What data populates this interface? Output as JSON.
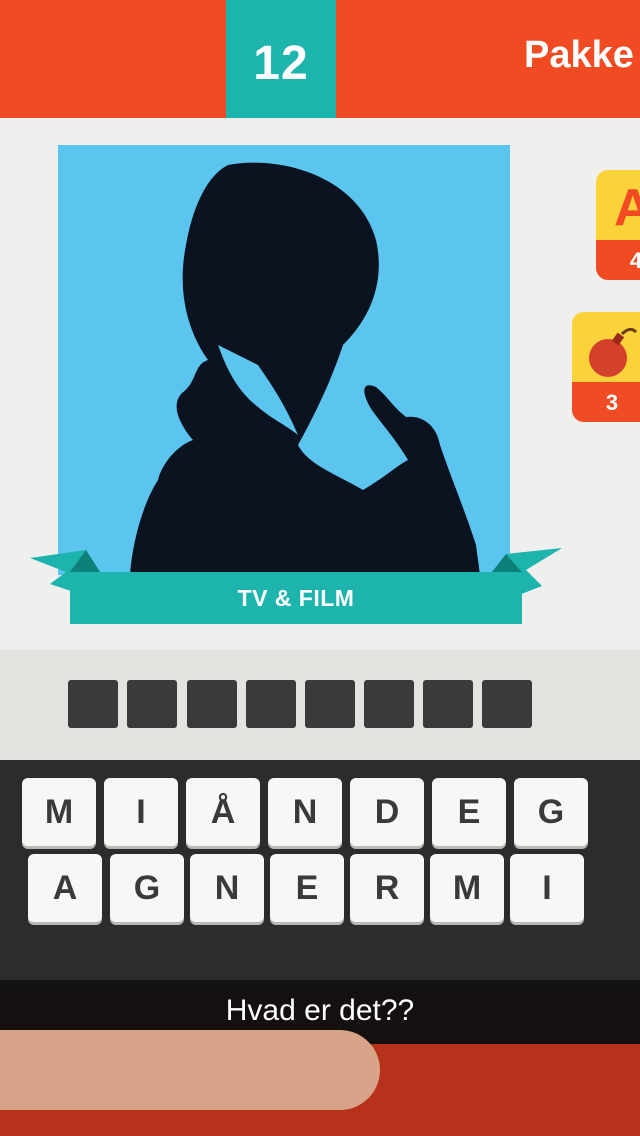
{
  "header": {
    "level_number": "12",
    "pack_label": "Pakke"
  },
  "picture": {
    "category_label": "TV & FILM"
  },
  "hints": [
    {
      "icon": "letter-hint-icon",
      "glyph": "A",
      "count": "4"
    },
    {
      "icon": "bomb-icon",
      "count": "3"
    }
  ],
  "answer": {
    "slot_count": 8
  },
  "keyboard": {
    "rows": [
      [
        "M",
        "I",
        "Å",
        "N",
        "D",
        "E",
        "G"
      ],
      [
        "A",
        "G",
        "N",
        "E",
        "R",
        "M",
        "I"
      ]
    ]
  },
  "caption": {
    "text": "Hvad er det??"
  },
  "colors": {
    "header_orange": "#f04b22",
    "teal": "#1db4ae",
    "picture_blue": "#5bc4ef",
    "hint_yellow": "#fbd23a"
  }
}
